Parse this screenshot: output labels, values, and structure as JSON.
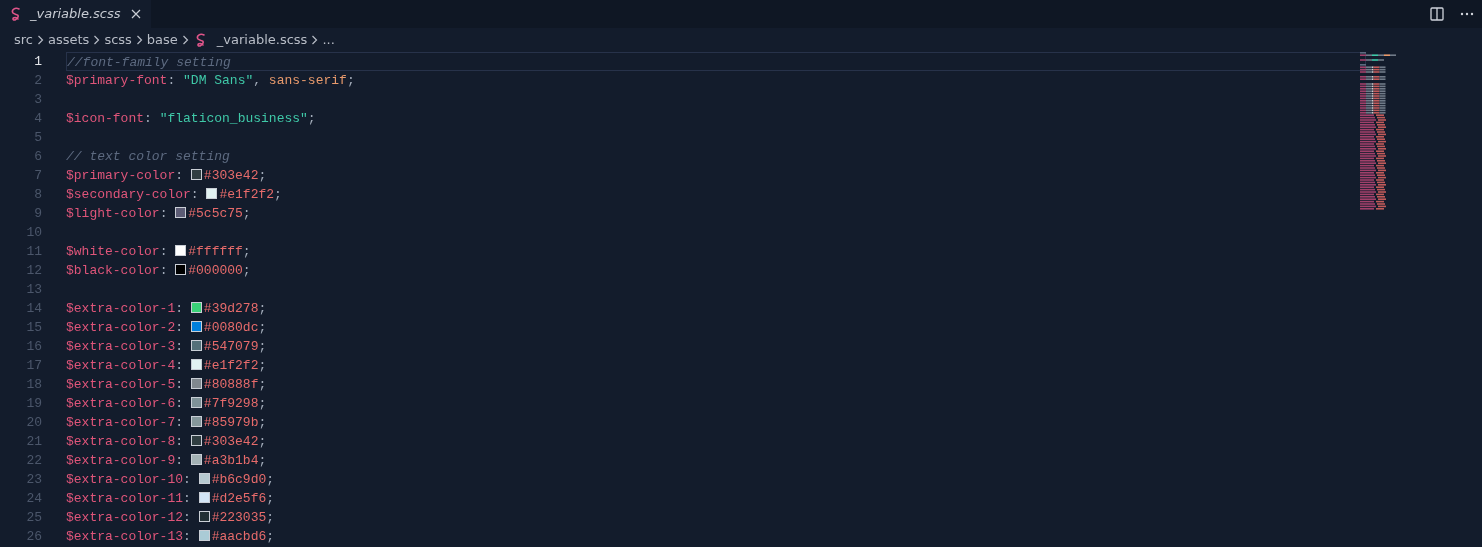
{
  "tab": {
    "label": "_variable.scss",
    "selected": true
  },
  "breadcrumbs": [
    {
      "label": "src",
      "icon": false
    },
    {
      "label": "assets",
      "icon": false
    },
    {
      "label": "scss",
      "icon": false
    },
    {
      "label": "base",
      "icon": false
    },
    {
      "label": "_variable.scss",
      "icon": true
    },
    {
      "label": "...",
      "icon": false
    }
  ],
  "lines": [
    {
      "number": "1",
      "selected": true,
      "tokens": [
        {
          "kind": "comment",
          "text": "//font-family setting"
        }
      ]
    },
    {
      "number": "2",
      "selected": false,
      "tokens": [
        {
          "kind": "var",
          "text": "$primary-font"
        },
        {
          "kind": "punct",
          "text": ": "
        },
        {
          "kind": "string",
          "text": "\"DM Sans\""
        },
        {
          "kind": "punct",
          "text": ", "
        },
        {
          "kind": "keyword",
          "text": "sans-serif"
        },
        {
          "kind": "punct",
          "text": ";"
        }
      ]
    },
    {
      "number": "3",
      "selected": false
    },
    {
      "number": "4",
      "selected": false,
      "tokens": [
        {
          "kind": "var",
          "text": "$icon-font"
        },
        {
          "kind": "punct",
          "text": ": "
        },
        {
          "kind": "string",
          "text": "\"flaticon_business\""
        },
        {
          "kind": "punct",
          "text": ";"
        }
      ]
    },
    {
      "number": "5",
      "selected": false
    },
    {
      "number": "6",
      "selected": false,
      "tokens": [
        {
          "kind": "comment",
          "text": "// text color setting"
        }
      ]
    },
    {
      "number": "7",
      "selected": false,
      "tokens": [
        {
          "kind": "var",
          "text": "$primary-color"
        },
        {
          "kind": "punct",
          "text": ": "
        },
        {
          "kind": "swatch",
          "color": "#303e42"
        },
        {
          "kind": "hex",
          "text": "#303e42"
        },
        {
          "kind": "punct",
          "text": ";"
        }
      ]
    },
    {
      "number": "8",
      "selected": false,
      "tokens": [
        {
          "kind": "var",
          "text": "$secondary-color"
        },
        {
          "kind": "punct",
          "text": ": "
        },
        {
          "kind": "swatch",
          "color": "#e1f2f2"
        },
        {
          "kind": "hex",
          "text": "#e1f2f2"
        },
        {
          "kind": "punct",
          "text": ";"
        }
      ]
    },
    {
      "number": "9",
      "selected": false,
      "tokens": [
        {
          "kind": "var",
          "text": "$light-color"
        },
        {
          "kind": "punct",
          "text": ": "
        },
        {
          "kind": "swatch",
          "color": "#5c5c75"
        },
        {
          "kind": "hex",
          "text": "#5c5c75"
        },
        {
          "kind": "punct",
          "text": ";"
        }
      ]
    },
    {
      "number": "10",
      "selected": false
    },
    {
      "number": "11",
      "selected": false,
      "tokens": [
        {
          "kind": "var",
          "text": "$white-color"
        },
        {
          "kind": "punct",
          "text": ": "
        },
        {
          "kind": "swatch",
          "color": "#ffffff"
        },
        {
          "kind": "hex",
          "text": "#ffffff"
        },
        {
          "kind": "punct",
          "text": ";"
        }
      ]
    },
    {
      "number": "12",
      "selected": false,
      "tokens": [
        {
          "kind": "var",
          "text": "$black-color"
        },
        {
          "kind": "punct",
          "text": ": "
        },
        {
          "kind": "swatch",
          "color": "#000000"
        },
        {
          "kind": "hex",
          "text": "#000000"
        },
        {
          "kind": "punct",
          "text": ";"
        }
      ]
    },
    {
      "number": "13",
      "selected": false
    },
    {
      "number": "14",
      "selected": false,
      "tokens": [
        {
          "kind": "var",
          "text": "$extra-color-1"
        },
        {
          "kind": "punct",
          "text": ": "
        },
        {
          "kind": "swatch",
          "color": "#39d278"
        },
        {
          "kind": "hex",
          "text": "#39d278"
        },
        {
          "kind": "punct",
          "text": ";"
        }
      ]
    },
    {
      "number": "15",
      "selected": false,
      "tokens": [
        {
          "kind": "var",
          "text": "$extra-color-2"
        },
        {
          "kind": "punct",
          "text": ": "
        },
        {
          "kind": "swatch",
          "color": "#0080dc"
        },
        {
          "kind": "hex",
          "text": "#0080dc"
        },
        {
          "kind": "punct",
          "text": ";"
        }
      ]
    },
    {
      "number": "16",
      "selected": false,
      "tokens": [
        {
          "kind": "var",
          "text": "$extra-color-3"
        },
        {
          "kind": "punct",
          "text": ": "
        },
        {
          "kind": "swatch",
          "color": "#547079"
        },
        {
          "kind": "hex",
          "text": "#547079"
        },
        {
          "kind": "punct",
          "text": ";"
        }
      ]
    },
    {
      "number": "17",
      "selected": false,
      "tokens": [
        {
          "kind": "var",
          "text": "$extra-color-4"
        },
        {
          "kind": "punct",
          "text": ": "
        },
        {
          "kind": "swatch",
          "color": "#e1f2f2"
        },
        {
          "kind": "hex",
          "text": "#e1f2f2"
        },
        {
          "kind": "punct",
          "text": ";"
        }
      ]
    },
    {
      "number": "18",
      "selected": false,
      "tokens": [
        {
          "kind": "var",
          "text": "$extra-color-5"
        },
        {
          "kind": "punct",
          "text": ": "
        },
        {
          "kind": "swatch",
          "color": "#80888f"
        },
        {
          "kind": "hex",
          "text": "#80888f"
        },
        {
          "kind": "punct",
          "text": ";"
        }
      ]
    },
    {
      "number": "19",
      "selected": false,
      "tokens": [
        {
          "kind": "var",
          "text": "$extra-color-6"
        },
        {
          "kind": "punct",
          "text": ": "
        },
        {
          "kind": "swatch",
          "color": "#7f9298"
        },
        {
          "kind": "hex",
          "text": "#7f9298"
        },
        {
          "kind": "punct",
          "text": ";"
        }
      ]
    },
    {
      "number": "20",
      "selected": false,
      "tokens": [
        {
          "kind": "var",
          "text": "$extra-color-7"
        },
        {
          "kind": "punct",
          "text": ": "
        },
        {
          "kind": "swatch",
          "color": "#85979b"
        },
        {
          "kind": "hex",
          "text": "#85979b"
        },
        {
          "kind": "punct",
          "text": ";"
        }
      ]
    },
    {
      "number": "21",
      "selected": false,
      "tokens": [
        {
          "kind": "var",
          "text": "$extra-color-8"
        },
        {
          "kind": "punct",
          "text": ": "
        },
        {
          "kind": "swatch",
          "color": "#303e42"
        },
        {
          "kind": "hex",
          "text": "#303e42"
        },
        {
          "kind": "punct",
          "text": ";"
        }
      ]
    },
    {
      "number": "22",
      "selected": false,
      "tokens": [
        {
          "kind": "var",
          "text": "$extra-color-9"
        },
        {
          "kind": "punct",
          "text": ": "
        },
        {
          "kind": "swatch",
          "color": "#a3b1b4"
        },
        {
          "kind": "hex",
          "text": "#a3b1b4"
        },
        {
          "kind": "punct",
          "text": ";"
        }
      ]
    },
    {
      "number": "23",
      "selected": false,
      "tokens": [
        {
          "kind": "var",
          "text": "$extra-color-10"
        },
        {
          "kind": "punct",
          "text": ": "
        },
        {
          "kind": "swatch",
          "color": "#b6c9d0"
        },
        {
          "kind": "hex",
          "text": "#b6c9d0"
        },
        {
          "kind": "punct",
          "text": ";"
        }
      ]
    },
    {
      "number": "24",
      "selected": false,
      "tokens": [
        {
          "kind": "var",
          "text": "$extra-color-11"
        },
        {
          "kind": "punct",
          "text": ": "
        },
        {
          "kind": "swatch",
          "color": "#d2e5f6"
        },
        {
          "kind": "hex",
          "text": "#d2e5f6"
        },
        {
          "kind": "punct",
          "text": ";"
        }
      ]
    },
    {
      "number": "25",
      "selected": false,
      "tokens": [
        {
          "kind": "var",
          "text": "$extra-color-12"
        },
        {
          "kind": "punct",
          "text": ": "
        },
        {
          "kind": "swatch",
          "color": "#223035"
        },
        {
          "kind": "hex",
          "text": "#223035"
        },
        {
          "kind": "punct",
          "text": ";"
        }
      ]
    },
    {
      "number": "26",
      "selected": false,
      "tokens": [
        {
          "kind": "var",
          "text": "$extra-color-13"
        },
        {
          "kind": "punct",
          "text": ": "
        },
        {
          "kind": "swatch",
          "color": "#aacbd6"
        },
        {
          "kind": "hex",
          "text": "#aacbd6"
        },
        {
          "kind": "punct",
          "text": ";"
        }
      ]
    }
  ]
}
